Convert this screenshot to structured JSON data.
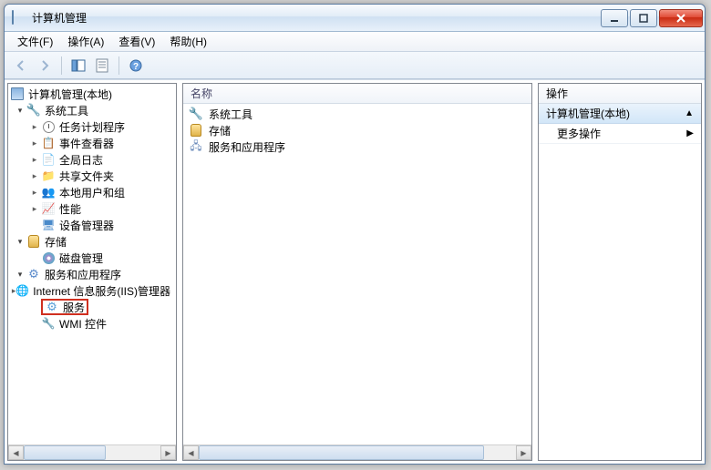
{
  "window": {
    "title": "计算机管理"
  },
  "menu": {
    "file": "文件(F)",
    "action": "操作(A)",
    "view": "查看(V)",
    "help": "帮助(H)"
  },
  "tree": {
    "root": "计算机管理(本地)",
    "systools": "系统工具",
    "scheduler": "任务计划程序",
    "event": "事件查看器",
    "logs": "全局日志",
    "shared": "共享文件夹",
    "users": "本地用户和组",
    "perf": "性能",
    "device": "设备管理器",
    "storage": "存储",
    "diskmgmt": "磁盘管理",
    "services_apps": "服务和应用程序",
    "iis": "Internet 信息服务(IIS)管理器",
    "services": "服务",
    "wmi": "WMI 控件"
  },
  "middle": {
    "header": "名称",
    "items": [
      {
        "icon": "wrench",
        "label": "系统工具"
      },
      {
        "icon": "db",
        "label": "存储"
      },
      {
        "icon": "server",
        "label": "服务和应用程序"
      }
    ]
  },
  "actions": {
    "header": "操作",
    "section": "计算机管理(本地)",
    "item1": "更多操作"
  }
}
